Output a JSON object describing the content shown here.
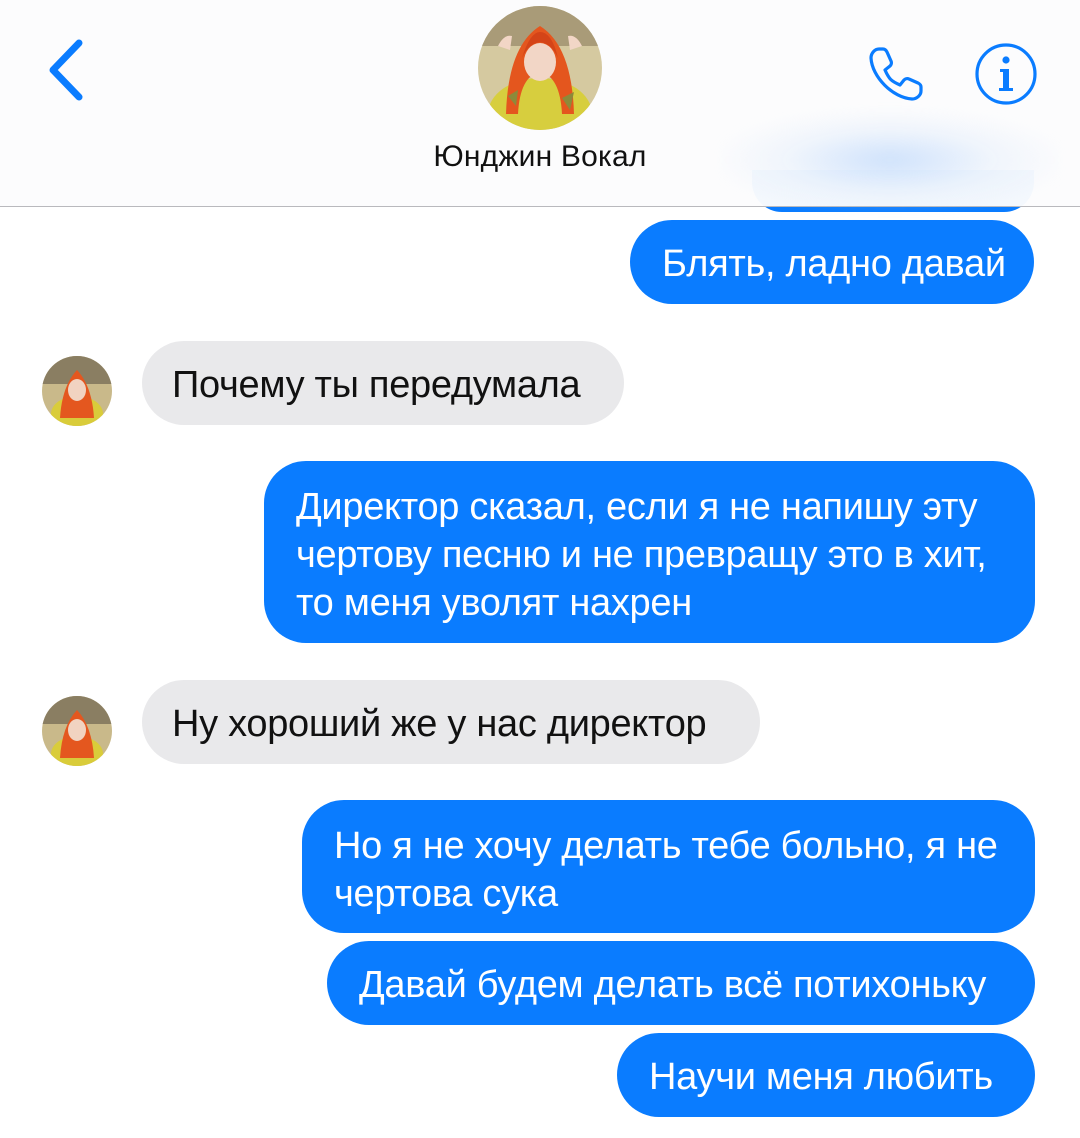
{
  "header": {
    "contact_name": "Юнджин Вокал",
    "back_icon": "chevron-left-icon",
    "call_icon": "phone-icon",
    "info_icon": "info-icon",
    "accent_color": "#0a7cff"
  },
  "messages": [
    {
      "direction": "sent",
      "text": ""
    },
    {
      "direction": "sent",
      "text": "Блять, ладно давай"
    },
    {
      "direction": "received",
      "text": "Почему ты передумала"
    },
    {
      "direction": "sent",
      "text": "Директор сказал, если я не напишу эту чертову песню и не превращу это в хит, то меня уволят нахрен"
    },
    {
      "direction": "received",
      "text": "Ну хороший же у нас директор"
    },
    {
      "direction": "sent",
      "text": "Но я не хочу делать тебе больно, я не чертова сука"
    },
    {
      "direction": "sent",
      "text": "Давай будем делать всё потихоньку"
    },
    {
      "direction": "sent",
      "text": "Научи меня любить"
    }
  ],
  "colors": {
    "sent_bubble": "#0a7cff",
    "received_bubble": "#e9e9eb",
    "sent_text": "#ffffff",
    "received_text": "#111111"
  }
}
